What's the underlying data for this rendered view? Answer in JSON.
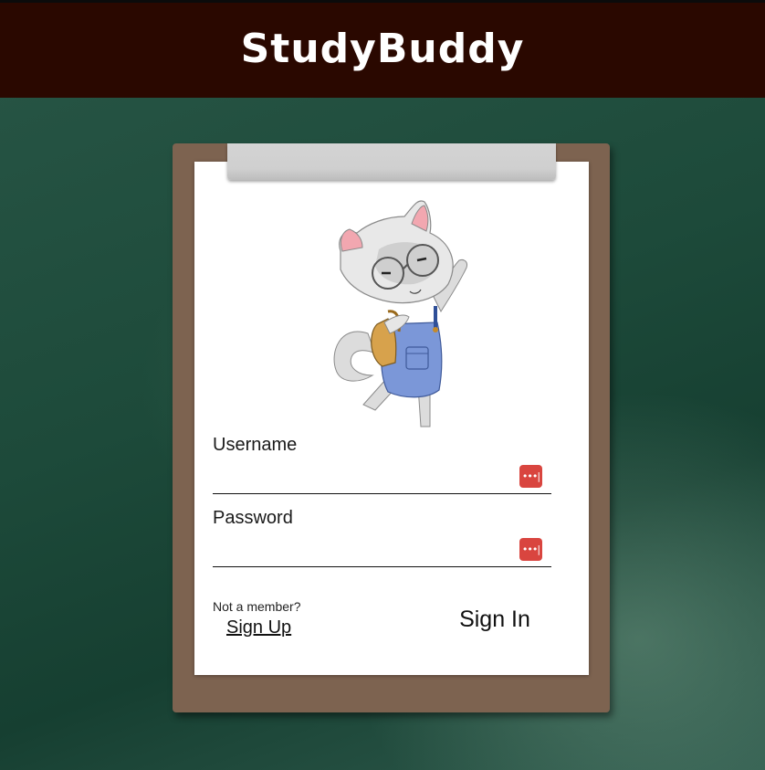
{
  "app": {
    "title": "StudyBuddy"
  },
  "form": {
    "username_label": "Username",
    "username_value": "",
    "password_label": "Password",
    "password_value": "",
    "password_manager_glyph": "•••|",
    "not_member_text": "Not a member?",
    "signup_label": "Sign Up",
    "signin_label": "Sign In"
  },
  "colors": {
    "header_bg": "#2a0800",
    "background": "#1d4a3a",
    "clipboard": "#7d6350",
    "clip": "#cfcfcf",
    "paper": "#ffffff",
    "password_manager_icon": "#d9453f"
  },
  "icons": {
    "mascot": "cat-mascot-with-glasses-backpack-overalls",
    "password_manager": "password-manager-icon"
  }
}
